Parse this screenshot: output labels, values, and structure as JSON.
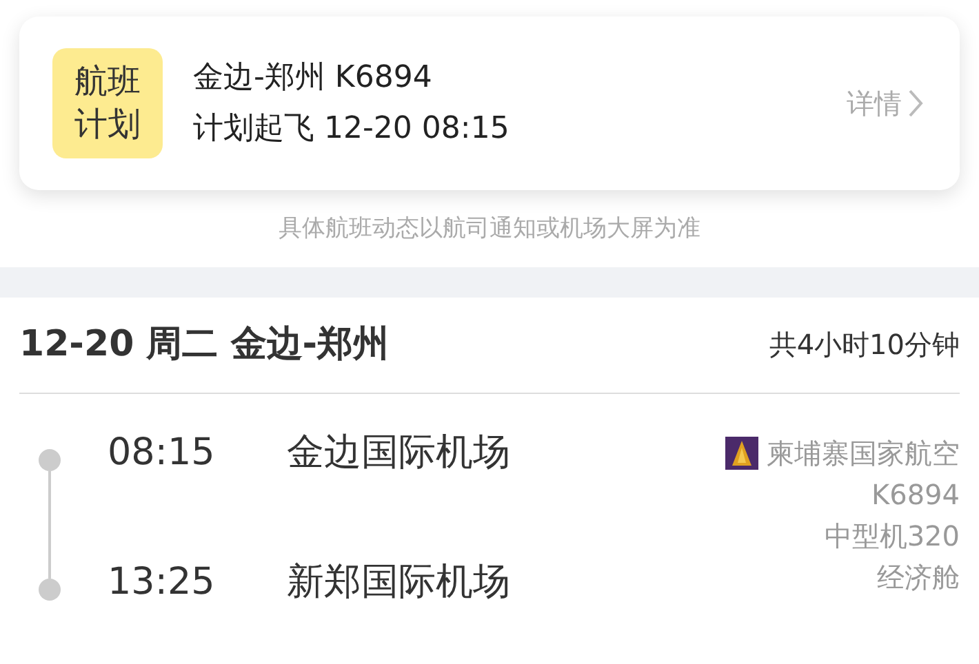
{
  "plan_card": {
    "badge": "航班计划",
    "route_flight": "金边-郑州 K6894",
    "scheduled": "计划起飞 12-20 08:15",
    "details_link": "详情"
  },
  "notice": "具体航班动态以航司通知或机场大屏为准",
  "itinerary": {
    "title": "12-20 周二 金边-郑州",
    "duration": "共4小时10分钟",
    "stops": [
      {
        "time": "08:15",
        "airport": "金边国际机场"
      },
      {
        "time": "13:25",
        "airport": "新郑国际机场"
      }
    ],
    "airline": "柬埔寨国家航空",
    "flight_no": "K6894",
    "aircraft": "中型机320",
    "cabin": "经济舱"
  }
}
